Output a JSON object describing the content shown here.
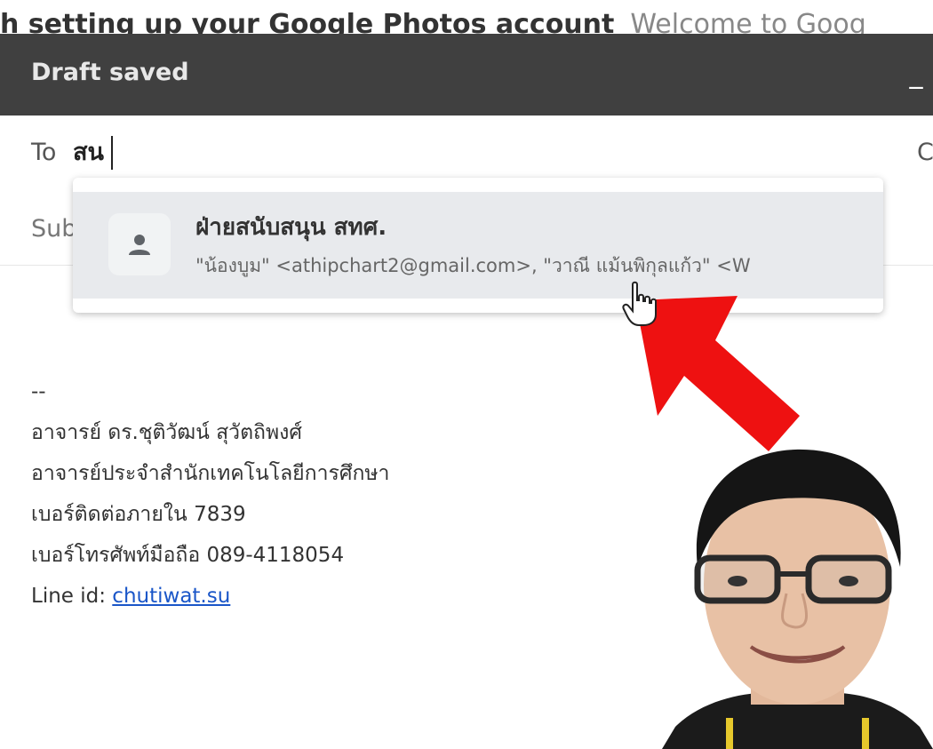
{
  "background_tab": {
    "subject": "h setting up your Google Photos account",
    "snippet": "Welcome to Goog"
  },
  "compose": {
    "title": "Draft saved",
    "minimize": "_",
    "to_label": "To",
    "to_value": "สน",
    "cc_label": "C",
    "subject_label": "Sub"
  },
  "suggestion": {
    "name": "ฝ่ายสนับสนุน สทศ.",
    "members": "\"น้องบูม\" <athipchart2@gmail.com>, \"วาณี แม้นพิกุลแก้ว\" <W"
  },
  "signature": {
    "dashes": "--",
    "line1": "อาจารย์ ดร.ชุติวัฒน์  สุวัตถิพงศ์",
    "line2": "อาจารย์ประจำสำนักเทคโนโลยีการศึกษา",
    "line3": "เบอร์ติดต่อภายใน 7839",
    "line4": "เบอร์โทรศัพท์มือถือ 089-4118054",
    "line5_label": "Line id:",
    "line5_link": "chutiwat.su"
  },
  "colors": {
    "titlebar": "#404040",
    "suggestion_bg": "#e8eaed",
    "link": "#1a56c8",
    "arrow": "#ee1111"
  },
  "icons": {
    "avatar": "person-icon",
    "pointer": "hand-cursor-icon",
    "annotation": "red-arrow-icon"
  }
}
